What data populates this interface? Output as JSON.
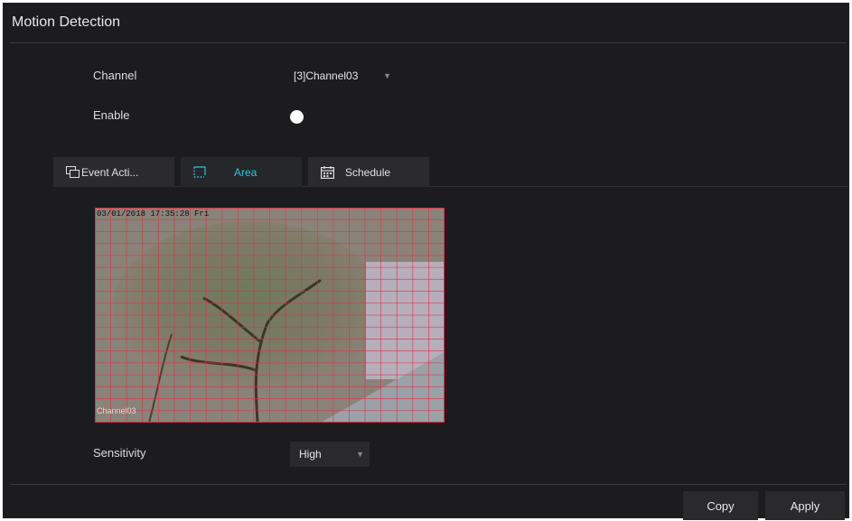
{
  "page": {
    "title": "Motion Detection"
  },
  "form": {
    "channel_label": "Channel",
    "channel_value": "[3]Channel03",
    "enable_label": "Enable",
    "enable_on": true,
    "sensitivity_label": "Sensitivity",
    "sensitivity_value": "High"
  },
  "tabs": [
    {
      "label": "Event Acti...",
      "icon": "event-action-icon",
      "active": false
    },
    {
      "label": "Area",
      "icon": "area-icon",
      "active": true
    },
    {
      "label": "Schedule",
      "icon": "calendar-icon",
      "active": false
    }
  ],
  "preview": {
    "timestamp": "03/01/2018 17:35:28 Fri",
    "channel_osd": "Channel03"
  },
  "buttons": {
    "copy": "Copy",
    "apply": "Apply"
  },
  "colors": {
    "accent": "#2fc3e0",
    "grid_line": "#e0304a",
    "background": "#1c1c1e"
  }
}
